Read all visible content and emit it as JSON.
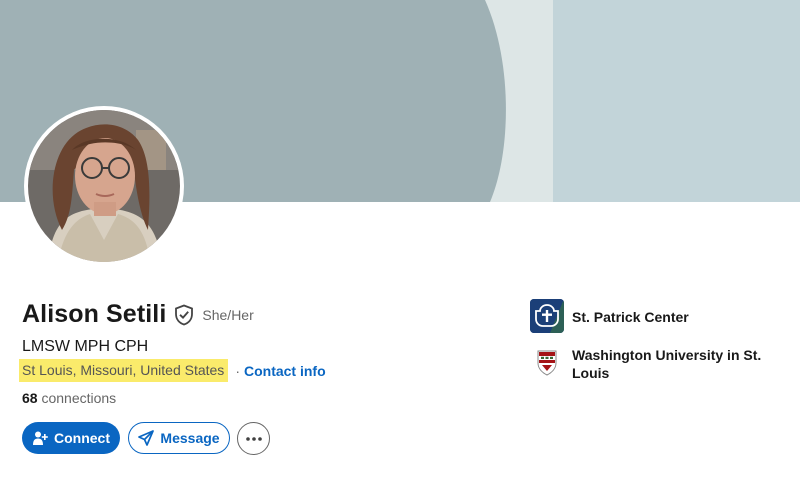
{
  "profile": {
    "name": "Alison Setili",
    "pronouns": "She/Her",
    "headline": "LMSW MPH CPH",
    "location": "St Louis, Missouri, United States",
    "separator": "·",
    "contact_info": "Contact info",
    "connections_count": "68",
    "connections_label": "connections"
  },
  "actions": {
    "connect_label": "Connect",
    "message_label": "Message",
    "more_icon": "ellipsis-icon"
  },
  "organizations": [
    {
      "name": "St. Patrick Center",
      "logo": "st-patrick-center-logo"
    },
    {
      "name": "Washington University in St. Louis",
      "logo": "washu-shield-logo"
    }
  ],
  "colors": {
    "accent": "#0a66c2",
    "banner_dark": "#9fb1b5",
    "banner_light": "#c2d4d9",
    "location_highlight": "#faeb6b"
  }
}
